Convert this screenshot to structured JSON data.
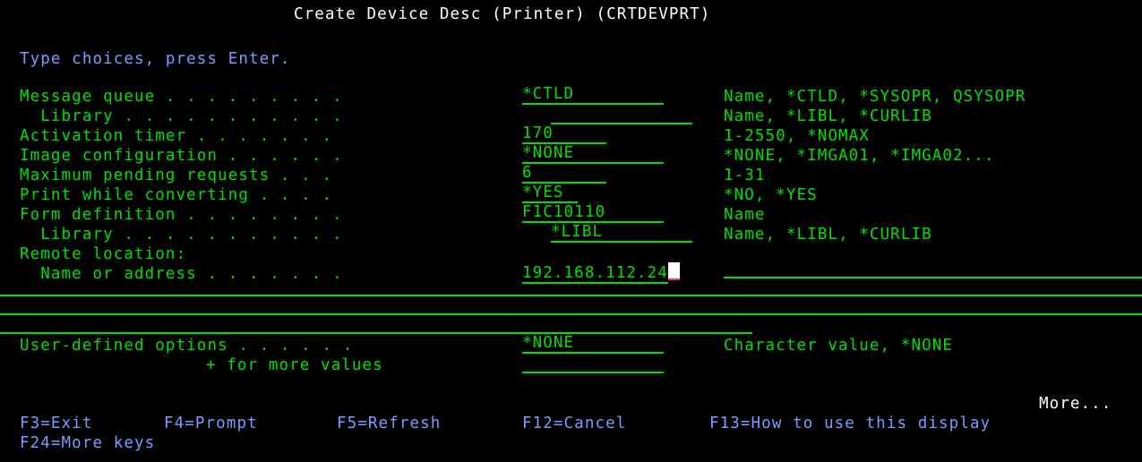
{
  "title": "Create Device Desc (Printer) (CRTDEVPRT)",
  "instruction": "Type choices, press Enter.",
  "params": [
    {
      "label": "Message queue . . . . . . . . .",
      "value": "*CTLD",
      "choices": "Name, *CTLD, *SYSOPR, QSYSOPR"
    },
    {
      "label": "  Library . . . . . . . . . . .",
      "value": "",
      "choices": "Name, *LIBL, *CURLIB"
    },
    {
      "label": "Activation timer . . . . . . .",
      "value": "170",
      "choices": "1-2550, *NOMAX"
    },
    {
      "label": "Image configuration . . . . . .",
      "value": "*NONE",
      "choices": "*NONE, *IMGA01, *IMGA02..."
    },
    {
      "label": "Maximum pending requests . . .",
      "value": "6",
      "choices": "1-31"
    },
    {
      "label": "Print while converting . . . .",
      "value": "*YES",
      "choices": "*NO, *YES"
    },
    {
      "label": "Form definition . . . . . . . .",
      "value": "F1C10110",
      "choices": "Name"
    },
    {
      "label": "  Library . . . . . . . . . . .",
      "value": "*LIBL",
      "choices": "Name, *LIBL, *CURLIB"
    }
  ],
  "remote_location": {
    "label": "Remote location:",
    "name_label": "  Name or address . . . . . . .",
    "value": "192.168.112.24"
  },
  "user_defined": {
    "label": "User-defined options . . . . . .",
    "value": "*NONE",
    "choices": "Character value, *NONE",
    "more_values_label": "+ for more values",
    "more_values_value": ""
  },
  "more_indicator": "More...",
  "function_keys": [
    {
      "label": "F3=Exit"
    },
    {
      "label": "F4=Prompt"
    },
    {
      "label": "F5=Refresh"
    },
    {
      "label": "F12=Cancel"
    },
    {
      "label": "F13=How to use this display"
    },
    {
      "label": "F24=More keys"
    }
  ],
  "colors": {
    "background": "#000000",
    "text_green": "#00e000",
    "title_white": "#ffffff",
    "instruction_blue": "#7b9bff",
    "cursor": "#ffffff"
  }
}
